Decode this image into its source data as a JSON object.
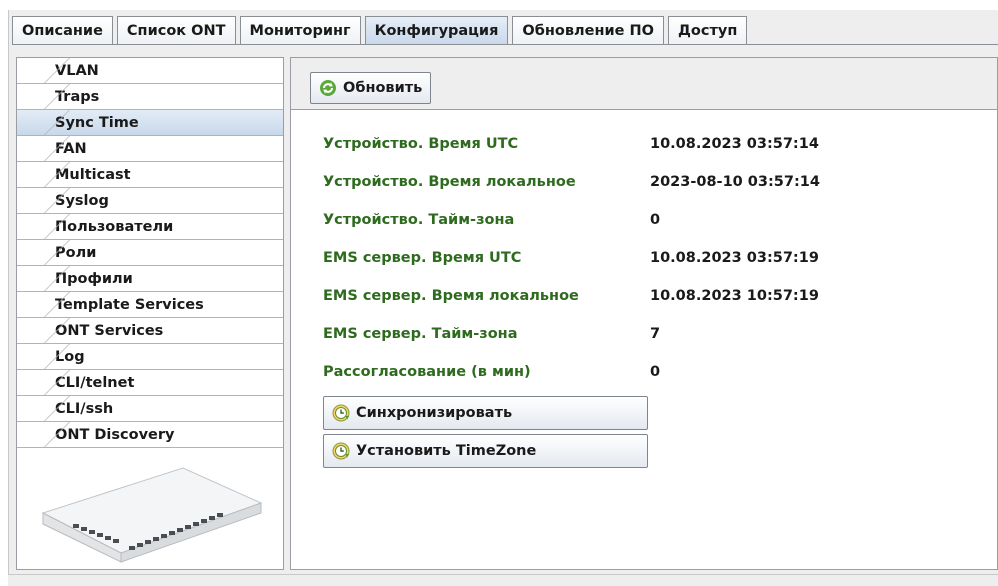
{
  "tabs": [
    {
      "label": "Описание"
    },
    {
      "label": "Список ONT"
    },
    {
      "label": "Мониторинг"
    },
    {
      "label": "Конфигурация",
      "active": true
    },
    {
      "label": "Обновление ПО"
    },
    {
      "label": "Доступ"
    }
  ],
  "sidebar": {
    "items": [
      {
        "label": "VLAN"
      },
      {
        "label": "Traps"
      },
      {
        "label": "Sync Time",
        "active": true
      },
      {
        "label": "FAN"
      },
      {
        "label": "Multicast"
      },
      {
        "label": "Syslog"
      },
      {
        "label": "Пользователи"
      },
      {
        "label": "Роли"
      },
      {
        "label": "Профили"
      },
      {
        "label": "Template Services"
      },
      {
        "label": "ONT Services"
      },
      {
        "label": "Log"
      },
      {
        "label": "CLI/telnet"
      },
      {
        "label": "CLI/ssh"
      },
      {
        "label": "ONT Discovery"
      }
    ]
  },
  "toolbar": {
    "refresh_label": "Обновить",
    "refresh_icon": "refresh-icon"
  },
  "info": {
    "rows": [
      {
        "label": "Устройство. Время UTC",
        "value": "10.08.2023 03:57:14"
      },
      {
        "label": "Устройство. Время локальное",
        "value": "2023-08-10 03:57:14"
      },
      {
        "label": "Устройство. Тайм-зона",
        "value": "0"
      },
      {
        "label": "EMS сервер. Время UTC",
        "value": "10.08.2023 03:57:19"
      },
      {
        "label": "EMS сервер. Время локальное",
        "value": "10.08.2023 10:57:19"
      },
      {
        "label": "EMS сервер. Тайм-зона",
        "value": "7"
      },
      {
        "label": "Рассогласование (в мин)",
        "value": "0"
      }
    ]
  },
  "actions": {
    "sync_label": "Синхронизировать",
    "timezone_label": "Установить TimeZone",
    "icon": "clock-icon"
  },
  "colors": {
    "label_green": "#2e6b1f",
    "active_tab": "#c9d8ea"
  }
}
